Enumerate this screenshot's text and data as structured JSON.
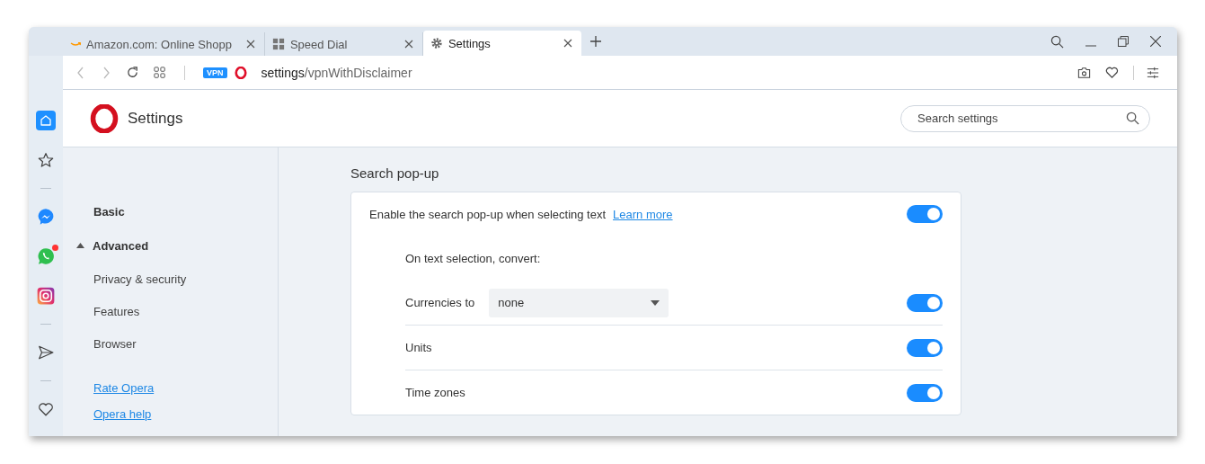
{
  "tabs": [
    {
      "title": "Amazon.com: Online Shopp",
      "kind": "page",
      "selected": false
    },
    {
      "title": "Speed Dial",
      "kind": "speed-dial",
      "selected": false
    },
    {
      "title": "Settings",
      "kind": "settings",
      "selected": true
    }
  ],
  "address_bar": {
    "vpn": "VPN",
    "url_host": "settings",
    "url_path": "/vpnWithDisclaimer"
  },
  "sidebar": {
    "groups": [
      {
        "items": [
          {
            "kind": "home",
            "selected": true,
            "notification": false
          },
          {
            "kind": "star",
            "selected": false,
            "notification": false
          }
        ]
      },
      {
        "items": [
          {
            "kind": "messenger",
            "selected": false,
            "notification": false
          },
          {
            "kind": "whatsapp",
            "selected": false,
            "notification": true
          },
          {
            "kind": "instagram",
            "selected": false,
            "notification": false
          }
        ]
      },
      {
        "items": [
          {
            "kind": "send",
            "selected": false,
            "notification": false
          }
        ]
      },
      {
        "items": [
          {
            "kind": "heart",
            "selected": false,
            "notification": false
          }
        ]
      }
    ]
  },
  "header": {
    "title": "Settings",
    "search": {
      "placeholder": "Search settings"
    }
  },
  "nav": {
    "items": [
      {
        "label": "Basic",
        "kind": "section"
      },
      {
        "label": "Advanced",
        "kind": "group",
        "expanded": true,
        "children": [
          {
            "label": "Privacy & security"
          },
          {
            "label": "Features"
          },
          {
            "label": "Browser"
          }
        ]
      }
    ],
    "links": [
      "Rate Opera",
      "Opera help"
    ]
  },
  "section": {
    "title": "Search pop-up",
    "main": {
      "label": "Enable the search pop-up when selecting text",
      "link": "Learn more",
      "on": true
    },
    "sublabel": "On text selection, convert:",
    "rows": [
      {
        "label": "Currencies to",
        "kind": "dropdown",
        "value": "none",
        "on": true
      },
      {
        "label": "Units",
        "kind": "toggle",
        "on": true
      },
      {
        "label": "Time zones",
        "kind": "toggle",
        "on": true
      }
    ]
  }
}
